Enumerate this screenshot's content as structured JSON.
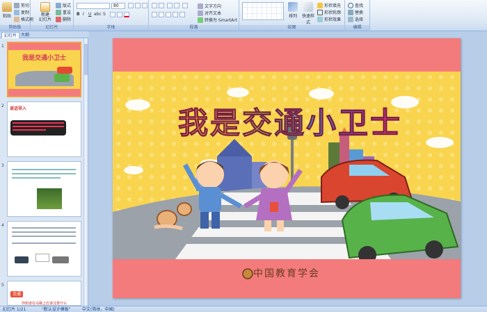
{
  "ribbon": {
    "clipboard": {
      "label": "剪贴板",
      "paste": "粘贴",
      "cut": "剪切",
      "copy": "复制",
      "format_painter": "格式刷"
    },
    "slides": {
      "label": "幻灯片",
      "new_slide": "新建\n幻灯片",
      "layout": "版式",
      "reset": "重设",
      "delete": "删除"
    },
    "font": {
      "label": "字体",
      "size": "80"
    },
    "paragraph": {
      "label": "段落",
      "text_direction": "文字方向",
      "align_text": "对齐文本",
      "smartart": "转换为 SmartArt"
    },
    "drawing": {
      "label": "绘图",
      "arrange": "排列",
      "quick_styles": "快速样式",
      "fill": "形状填充",
      "outline": "形状轮廓",
      "effects": "形状效果"
    },
    "editing": {
      "label": "编辑",
      "find": "查找",
      "replace": "替换",
      "select": "选择"
    }
  },
  "leftpane": {
    "tab_slides": "幻灯片",
    "tab_outline": "大纲",
    "thumbs": [
      {
        "num": "1",
        "title": "我是交通小卫士"
      },
      {
        "num": "2",
        "title": "谈话导入"
      },
      {
        "num": "3",
        "text": "小朋友们去上学"
      },
      {
        "num": "4",
        "text": "过马路注意安全"
      },
      {
        "num": "5",
        "title": "交通",
        "text": "你知道在马路上应该注意什么"
      }
    ]
  },
  "slide": {
    "title": "我是交通小卫士",
    "footer": "中国教育学会"
  },
  "statusbar": {
    "slide_count": "幻灯片 1/21",
    "theme": "\"默认设计模板\"",
    "language": "中文(简体，中国)"
  },
  "colors": {
    "slide_bg": "#f47b7c",
    "slide_yellow": "#f9d44e",
    "accent": "#f2a142"
  }
}
